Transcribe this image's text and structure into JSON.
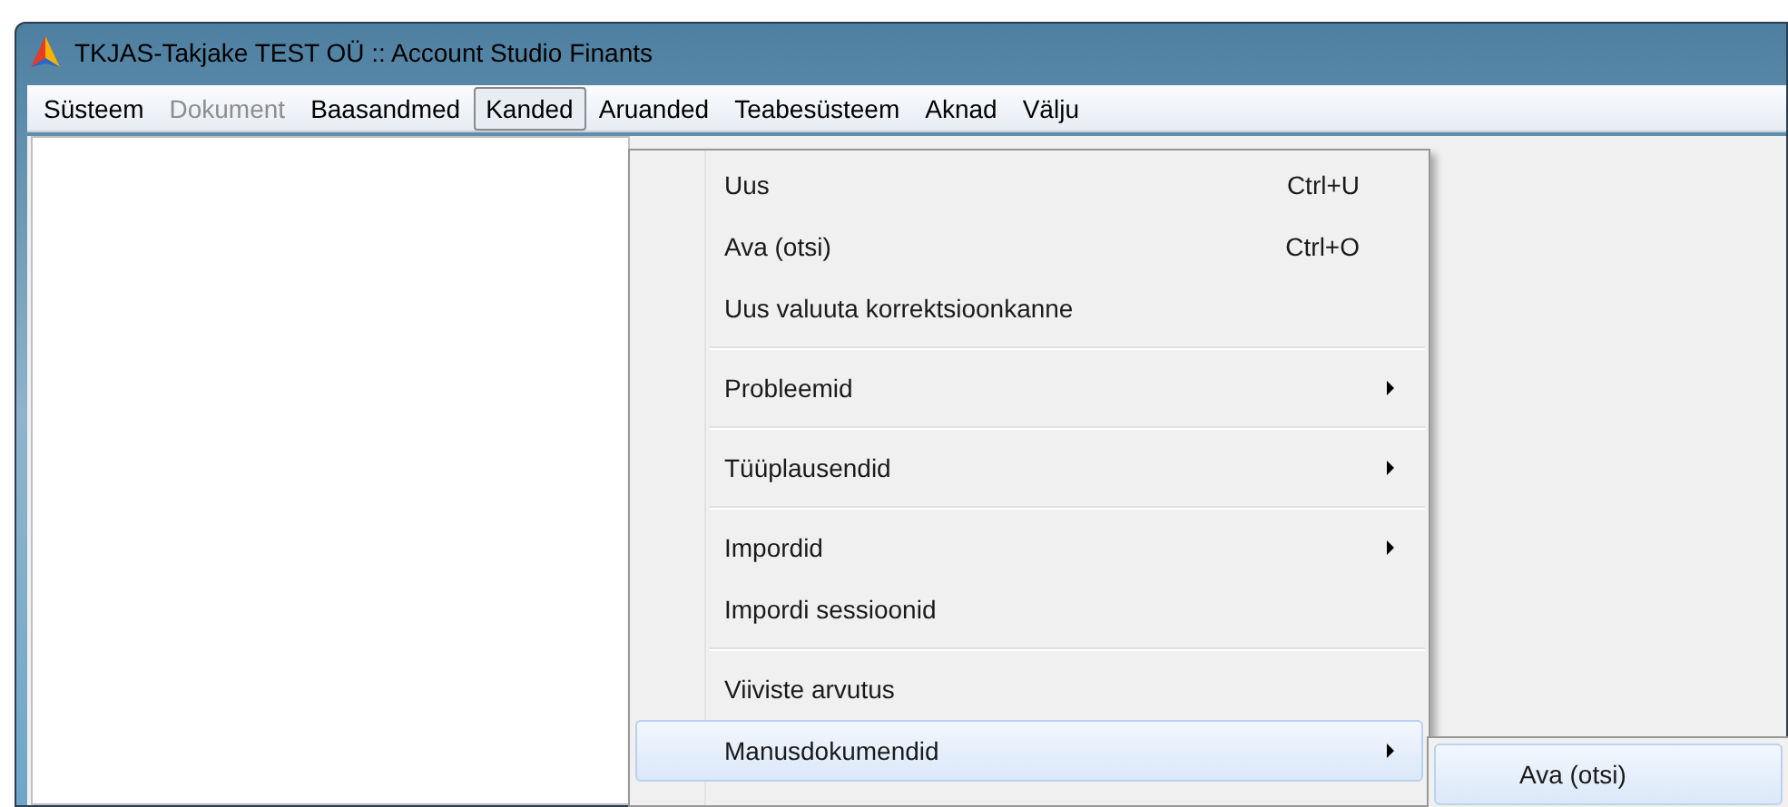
{
  "window": {
    "title": "TKJAS-Takjake TEST OÜ :: Account Studio Finants"
  },
  "menu_bar": [
    {
      "label": "Süsteem",
      "selected": false,
      "disabled": false
    },
    {
      "label": "Dokument",
      "selected": false,
      "disabled": true
    },
    {
      "label": "Baasandmed",
      "selected": false,
      "disabled": false
    },
    {
      "label": "Kanded",
      "selected": true,
      "disabled": false
    },
    {
      "label": "Aruanded",
      "selected": false,
      "disabled": false
    },
    {
      "label": "Teabesüsteem",
      "selected": false,
      "disabled": false
    },
    {
      "label": "Aknad",
      "selected": false,
      "disabled": false
    },
    {
      "label": "Välju",
      "selected": false,
      "disabled": false
    }
  ],
  "dropdown": [
    {
      "kind": "item",
      "label": "Uus",
      "shortcut": "Ctrl+U",
      "submenu": false,
      "selected": false
    },
    {
      "kind": "item",
      "label": "Ava (otsi)",
      "shortcut": "Ctrl+O",
      "submenu": false,
      "selected": false
    },
    {
      "kind": "item",
      "label": "Uus valuuta korrektsioonkanne",
      "submenu": false,
      "selected": false
    },
    {
      "kind": "separator"
    },
    {
      "kind": "item",
      "label": "Probleemid",
      "submenu": true,
      "selected": false
    },
    {
      "kind": "separator"
    },
    {
      "kind": "item",
      "label": "Tüüplausendid",
      "submenu": true,
      "selected": false
    },
    {
      "kind": "separator"
    },
    {
      "kind": "item",
      "label": "Impordid",
      "submenu": true,
      "selected": false
    },
    {
      "kind": "item",
      "label": "Impordi sessioonid",
      "submenu": false,
      "selected": false
    },
    {
      "kind": "separator"
    },
    {
      "kind": "item",
      "label": "Viiviste arvutus",
      "submenu": false,
      "selected": false
    },
    {
      "kind": "item",
      "label": "Manusdokumendid",
      "submenu": true,
      "selected": true
    }
  ],
  "submenu": [
    {
      "label": "Ava (otsi)",
      "selected": true
    }
  ]
}
